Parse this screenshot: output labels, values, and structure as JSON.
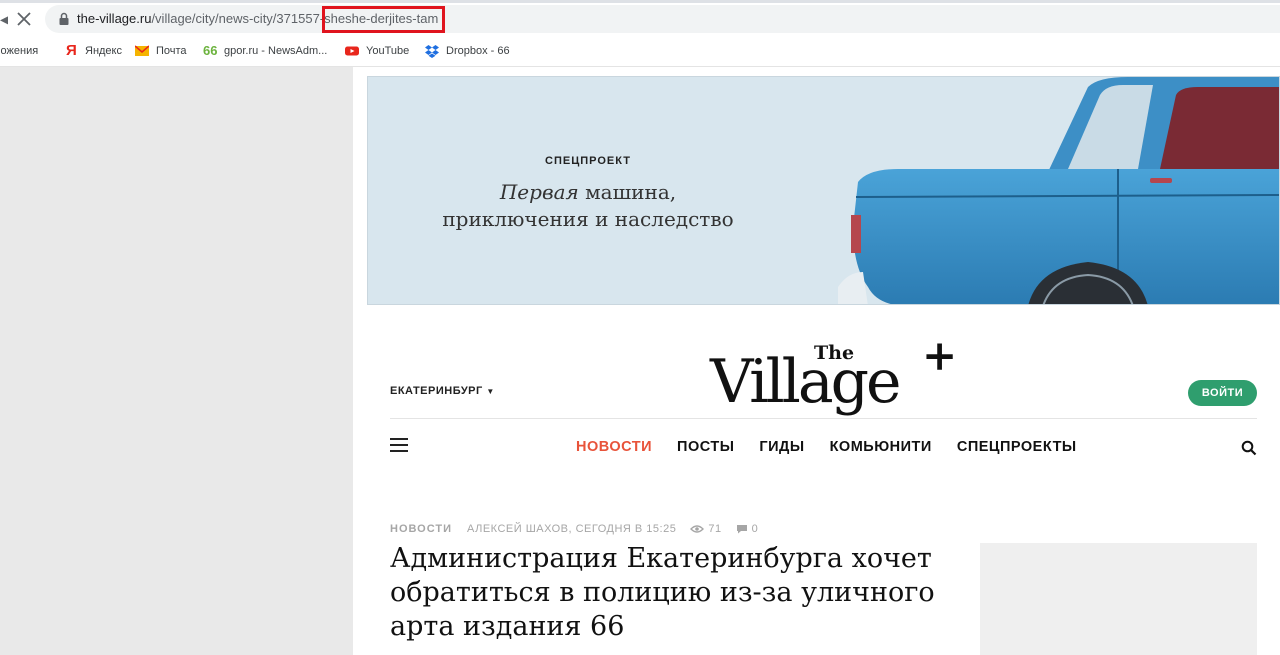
{
  "browser": {
    "url_domain": "the-village.ru",
    "url_path": "/village/city/news-city/371557-sheshe-derjites-tam",
    "icons": [
      "back-icon",
      "close-icon",
      "lock-icon"
    ]
  },
  "bookmarks": [
    {
      "label": "ложения",
      "icon": "apps-icon"
    },
    {
      "label": "Яндекс",
      "icon": "yandex-icon"
    },
    {
      "label": "Почта",
      "icon": "mail-icon"
    },
    {
      "label": "gpor.ru - NewsAdm...",
      "icon": "gpor-icon"
    },
    {
      "label": "YouTube",
      "icon": "youtube-icon"
    },
    {
      "label": "Dropbox - 66",
      "icon": "dropbox-icon"
    }
  ],
  "banner": {
    "label": "СПЕЦПРОЕКТ",
    "title_italic": "Первая",
    "title_rest": " машина,",
    "title_line2": "приключения и наследство"
  },
  "header": {
    "city": "ЕКАТЕРИНБУРГ",
    "logo_the": "The",
    "logo_word": "Village",
    "login": "ВОЙТИ",
    "menu": [
      {
        "label": "НОВОСТИ",
        "active": true
      },
      {
        "label": "ПОСТЫ",
        "active": false
      },
      {
        "label": "ГИДЫ",
        "active": false
      },
      {
        "label": "КОМЬЮНИТИ",
        "active": false
      },
      {
        "label": "СПЕЦПРОЕКТЫ",
        "active": false
      }
    ]
  },
  "article": {
    "category": "НОВОСТИ",
    "author_time": "АЛЕКСЕЙ ШАХОВ, СЕГОДНЯ В 15:25",
    "views": "71",
    "comments": "0",
    "headline": "Администрация Екатеринбурга хочет обратиться в полицию из-за уличного арта издания 66"
  },
  "colors": {
    "accent_red": "#e8533a",
    "login_green": "#2f9e6e",
    "highlight_box": "#e0141e",
    "car_blue": "#3a8fc4"
  }
}
